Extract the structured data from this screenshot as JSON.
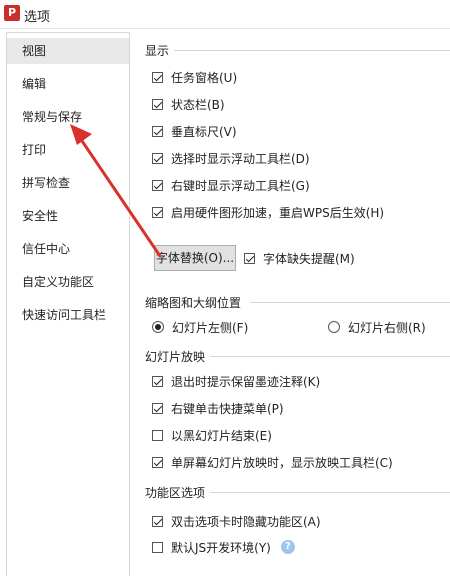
{
  "window": {
    "title": "选项",
    "logo_letter": "P"
  },
  "sidebar": {
    "items": [
      {
        "label": "视图",
        "selected": true
      },
      {
        "label": "编辑"
      },
      {
        "label": "常规与保存"
      },
      {
        "label": "打印"
      },
      {
        "label": "拼写检查"
      },
      {
        "label": "安全性"
      },
      {
        "label": "信任中心"
      },
      {
        "label": "自定义功能区"
      },
      {
        "label": "快速访问工具栏"
      }
    ]
  },
  "display": {
    "title": "显示",
    "options": [
      {
        "label": "任务窗格(U)",
        "checked": true
      },
      {
        "label": "状态栏(B)",
        "checked": true
      },
      {
        "label": "垂直标尺(V)",
        "checked": true
      },
      {
        "label": "选择时显示浮动工具栏(D)",
        "checked": true
      },
      {
        "label": "右键时显示浮动工具栏(G)",
        "checked": true
      },
      {
        "label": "启用硬件图形加速，重启WPS后生效(H)",
        "checked": true
      }
    ],
    "font_replace_button": "字体替换(O)...",
    "font_missing_hint": {
      "label": "字体缺失提醒(M)",
      "checked": true
    }
  },
  "thumbnail": {
    "title": "缩略图和大纲位置",
    "left": {
      "label": "幻灯片左侧(F)",
      "selected": true
    },
    "right": {
      "label": "幻灯片右侧(R)",
      "selected": false
    }
  },
  "slideshow": {
    "title": "幻灯片放映",
    "options": [
      {
        "label": "退出时提示保留墨迹注释(K)",
        "checked": true
      },
      {
        "label": "右键单击快捷菜单(P)",
        "checked": true
      },
      {
        "label": "以黑幻灯片结束(E)",
        "checked": false
      },
      {
        "label": "单屏幕幻灯片放映时，显示放映工具栏(C)",
        "checked": true
      }
    ]
  },
  "ribbon": {
    "title": "功能区选项",
    "options": [
      {
        "label": "双击选项卡时隐藏功能区(A)",
        "checked": true
      },
      {
        "label": "默认JS开发环境(Y)",
        "checked": false
      }
    ],
    "help_glyph": "?"
  },
  "colors": {
    "arrow": "#d9312b",
    "accent": "#c9302c"
  }
}
